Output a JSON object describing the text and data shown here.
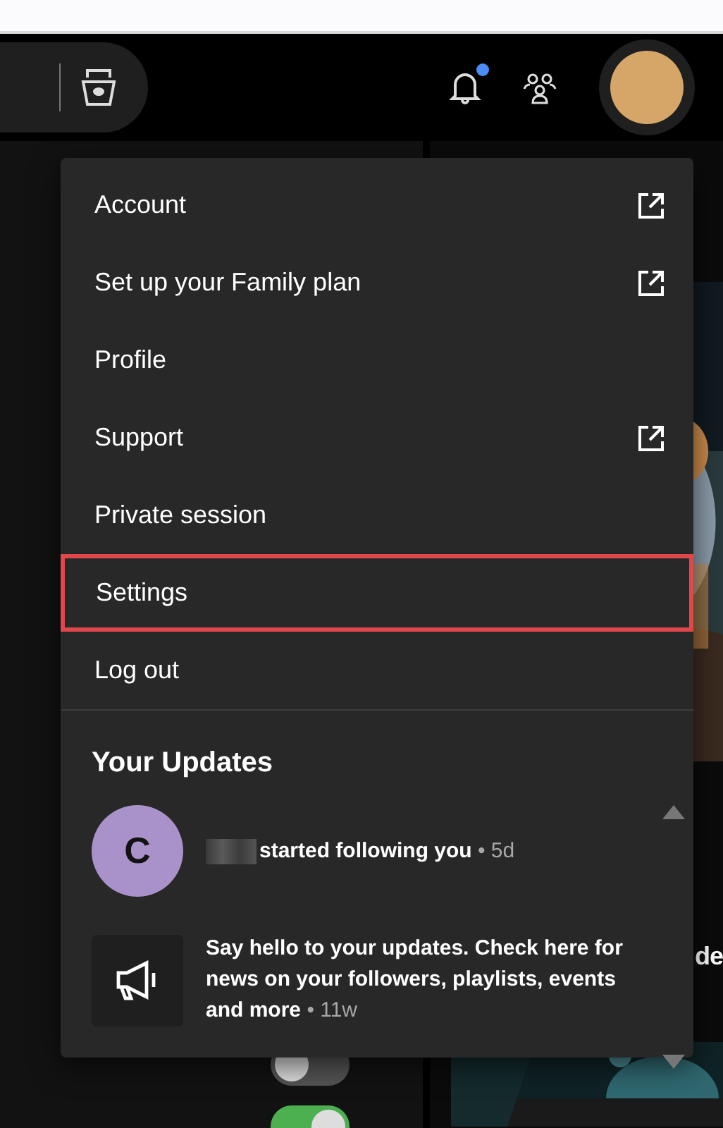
{
  "header": {
    "notification_dot": true
  },
  "menu": {
    "items": [
      {
        "label": "Account",
        "external": true,
        "highlighted": false
      },
      {
        "label": "Set up your Family plan",
        "external": true,
        "highlighted": false
      },
      {
        "label": "Profile",
        "external": false,
        "highlighted": false
      },
      {
        "label": "Support",
        "external": true,
        "highlighted": false
      },
      {
        "label": "Private session",
        "external": false,
        "highlighted": false
      },
      {
        "label": "Settings",
        "external": false,
        "highlighted": true
      },
      {
        "label": "Log out",
        "external": false,
        "highlighted": false
      }
    ],
    "updates_title": "Your Updates",
    "updates": [
      {
        "kind": "follow",
        "initial": "C",
        "text": "started following you",
        "time": "• 5d",
        "redacted": true
      },
      {
        "kind": "announcement",
        "text": "Say hello to your updates. Check here for news on your followers, playlists, events and more",
        "time": "• 11w"
      }
    ]
  },
  "background": {
    "title_fragment": "de",
    "toggles": [
      {
        "on": false
      },
      {
        "on": true
      }
    ]
  }
}
